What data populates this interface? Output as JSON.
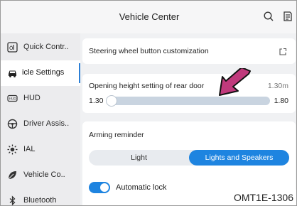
{
  "header": {
    "title": "Vehicle Center",
    "search_icon": "search-icon",
    "menu_icon": "document-menu-icon"
  },
  "sidebar": {
    "items": [
      {
        "label": "Quick Contr..",
        "icon": "quick-control-icon",
        "active": false
      },
      {
        "label": "icle Settings",
        "icon": "car-icon",
        "active": true
      },
      {
        "label": "HUD",
        "icon": "hud-icon",
        "active": false
      },
      {
        "label": "Driver Assis..",
        "icon": "steering-wheel-icon",
        "active": false
      },
      {
        "label": "IAL",
        "icon": "ambient-light-icon",
        "active": false
      },
      {
        "label": "Vehicle Co..",
        "icon": "leaf-icon",
        "active": false
      },
      {
        "label": "Bluetooth",
        "icon": "bluetooth-icon",
        "active": false
      }
    ]
  },
  "main": {
    "steering_card": {
      "label": "Steering wheel button customization",
      "icon": "external-link-icon"
    },
    "rear_door_card": {
      "label": "Opening height setting of rear door",
      "current_value": "1.30m",
      "min_label": "1.30",
      "max_label": "1.80",
      "slider_level": 0.0
    },
    "arming_card": {
      "label": "Arming reminder",
      "options": [
        "Light",
        "Lights and Speakers"
      ],
      "selected": "Lights and Speakers",
      "auto_lock_label": "Automatic lock",
      "auto_lock_on": true
    }
  },
  "annotation": {
    "code": "OMT1E-1306"
  },
  "colors": {
    "accent": "#1e84e0",
    "slider_track": "#c9d4e0",
    "arrow_fill": "#c03a7c"
  }
}
